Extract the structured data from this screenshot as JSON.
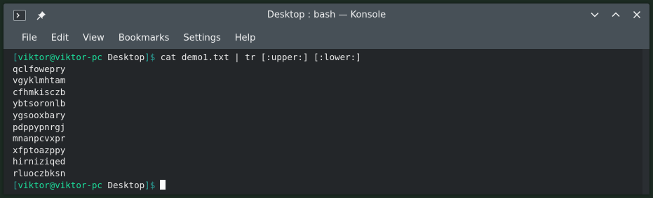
{
  "window": {
    "title": "Desktop : bash — Konsole"
  },
  "titlebar_icons": {
    "app": "konsole-icon",
    "pin": "pin-icon",
    "minimize": "chevron-down-icon",
    "maximize": "chevron-up-icon",
    "close": "close-icon"
  },
  "menu": {
    "file": "File",
    "edit": "Edit",
    "view": "View",
    "bookmarks": "Bookmarks",
    "settings": "Settings",
    "help": "Help"
  },
  "terminal": {
    "prompt1": {
      "open": "[",
      "user": "viktor@viktor-pc",
      "dir": " Desktop",
      "close": "]$",
      "command": " cat demo1.txt | tr [:upper:] [:lower:]"
    },
    "output": [
      "qclfowepry",
      "vgyklmhtam",
      "cfhmkisczb",
      "ybtsoronlb",
      "ygsooxbary",
      "pdppypnrgj",
      "mnanpcvxpr",
      "xfptoazppy",
      "hirniziqed",
      "rluoczbksn"
    ],
    "prompt2": {
      "open": "[",
      "user": "viktor@viktor-pc",
      "dir": " Desktop",
      "close": "]$"
    }
  },
  "colors": {
    "titlebar": "#475057",
    "terminal_bg": "#232629",
    "prompt_user": "#1cdc9a",
    "prompt_bracket": "#2aa198"
  }
}
